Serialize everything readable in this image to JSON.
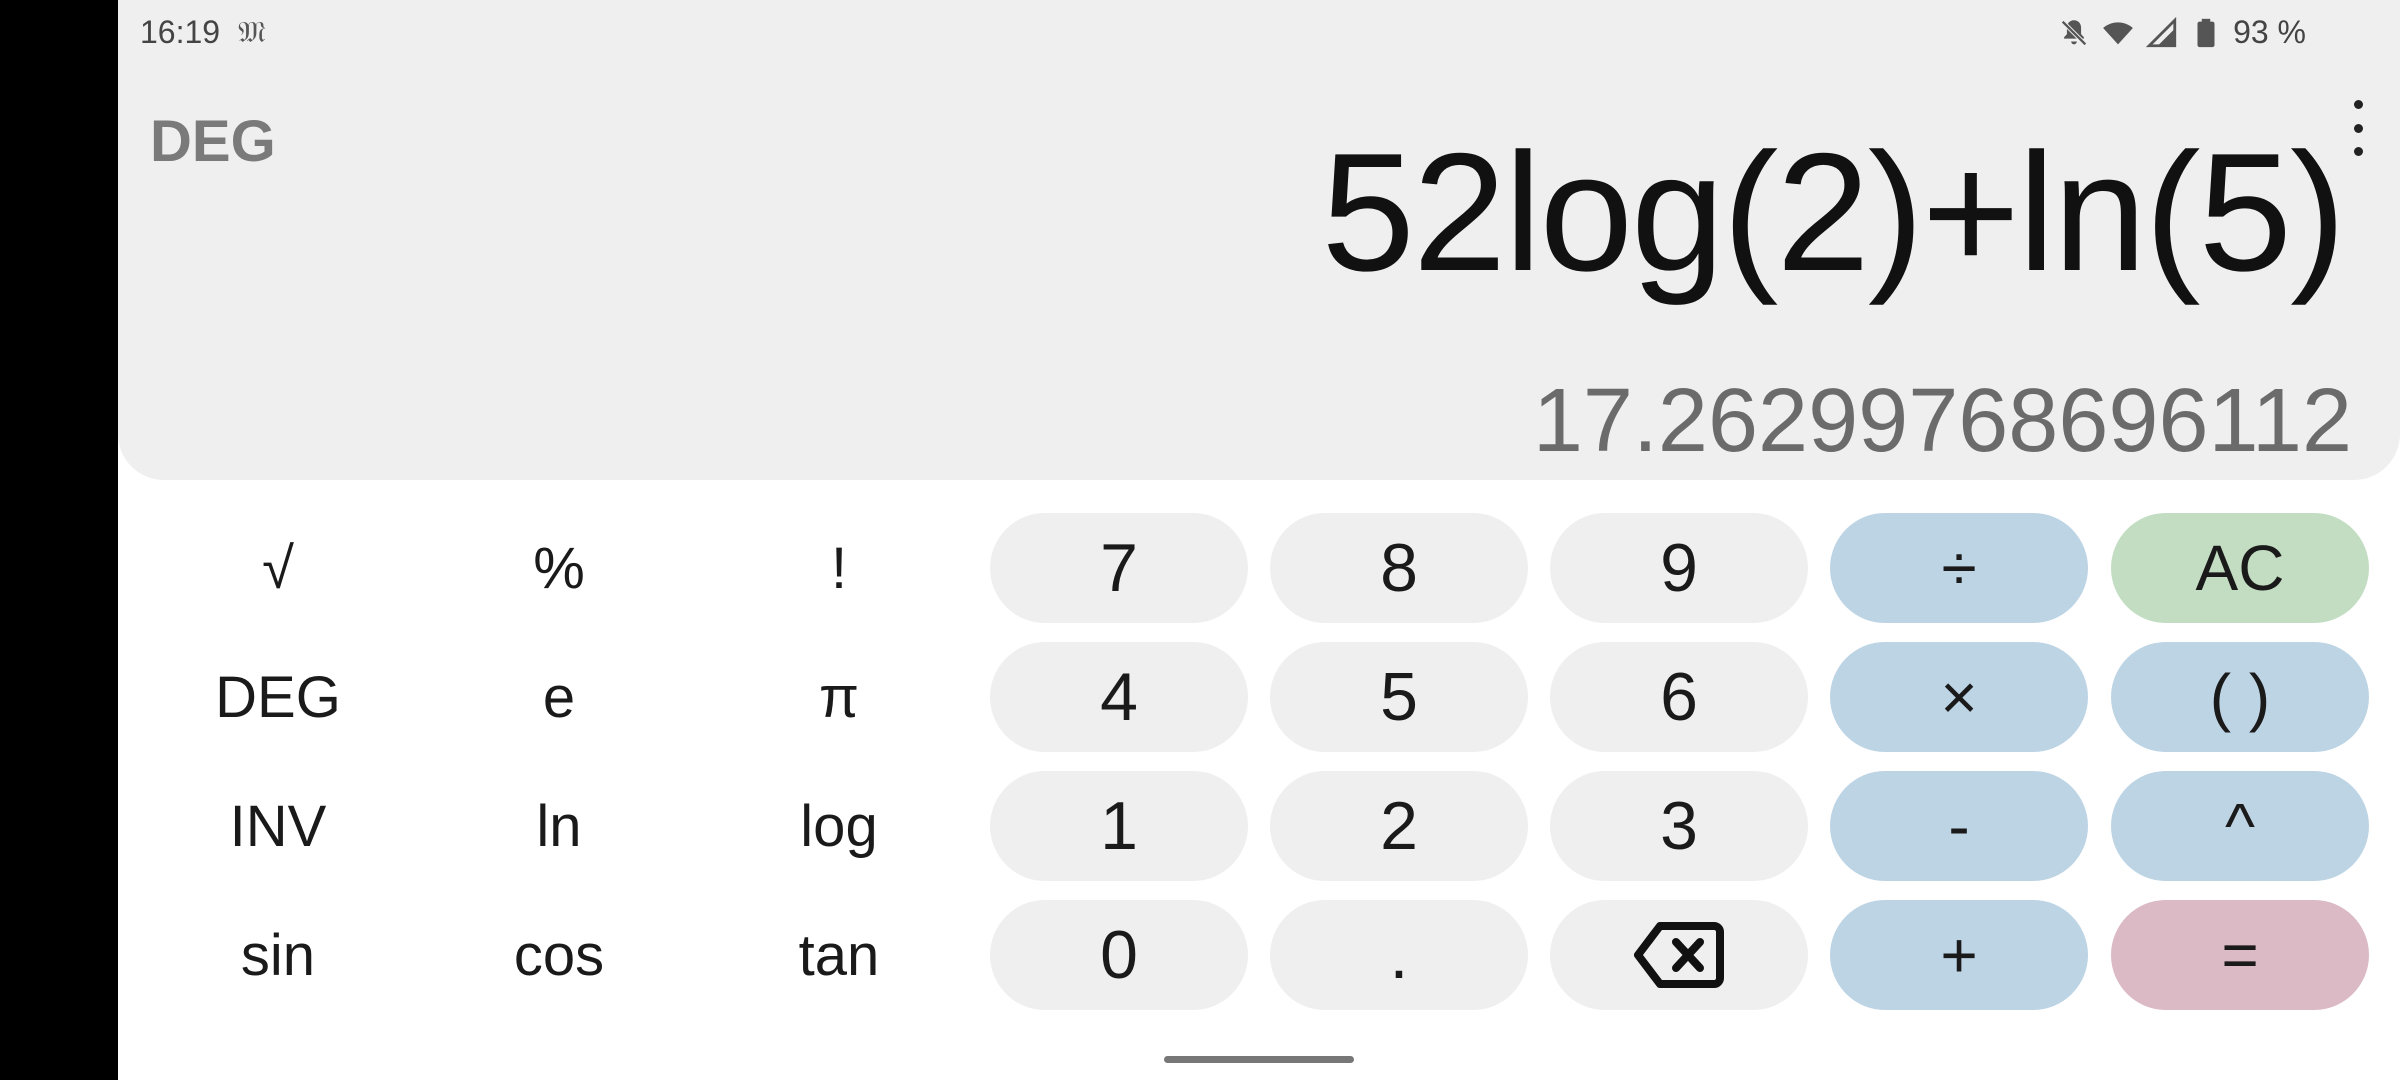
{
  "status_bar": {
    "time": "16:19",
    "notification_glyph": "𝔐",
    "battery_percent": "93 %",
    "icons": [
      "notifications-off-icon",
      "wifi-icon",
      "signal-icon",
      "battery-icon"
    ]
  },
  "display": {
    "mode": "DEG",
    "expression": "52log(2)+ln(5)",
    "result": "17.26299768696112"
  },
  "keys": {
    "sqrt": "√",
    "percent": "%",
    "factorial": "!",
    "deg": "DEG",
    "e": "e",
    "pi": "π",
    "inv": "INV",
    "ln": "ln",
    "log": "log",
    "sin": "sin",
    "cos": "cos",
    "tan": "tan",
    "seven": "7",
    "eight": "8",
    "nine": "9",
    "four": "4",
    "five": "5",
    "six": "6",
    "one": "1",
    "two": "2",
    "three": "3",
    "zero": "0",
    "decimal": ".",
    "divide": "÷",
    "multiply": "×",
    "minus": "-",
    "plus": "+",
    "clear": "AC",
    "parentheses": "( )",
    "power": "^",
    "equals": "="
  },
  "colors": {
    "display_bg": "#efefef",
    "number_key_bg": "#efefef",
    "operator_key_bg": "#bdd4e5",
    "clear_key_bg": "#c3ddc3",
    "equals_key_bg": "#dbb9c5"
  }
}
